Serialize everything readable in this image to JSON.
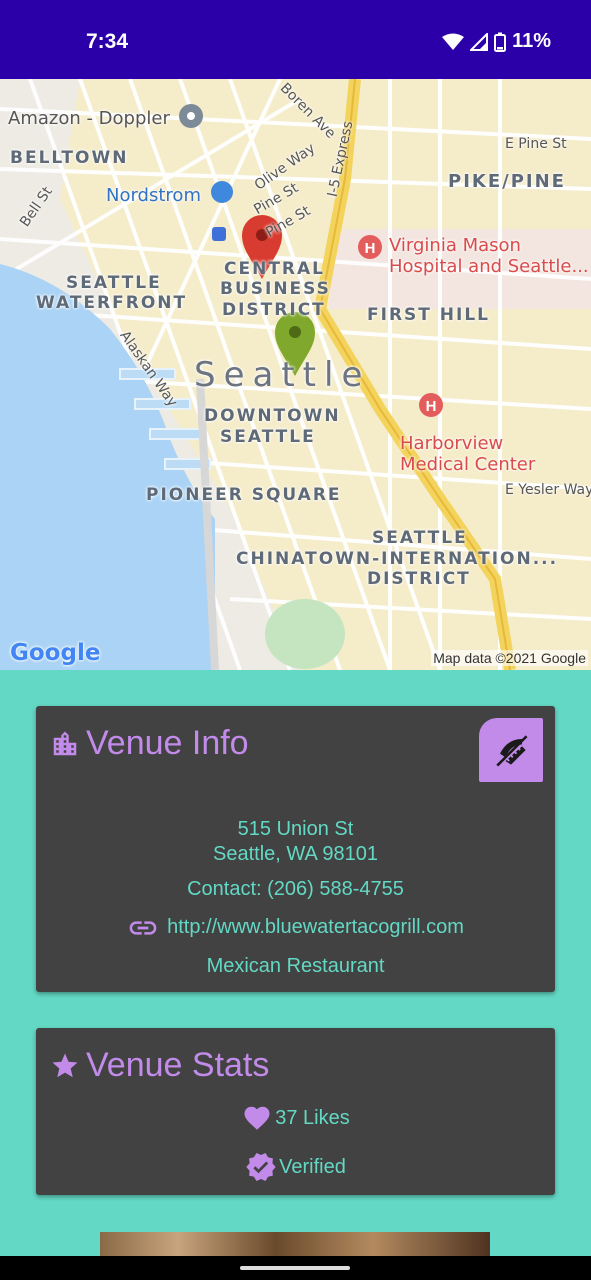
{
  "status_bar": {
    "time": "7:34",
    "battery": "11%"
  },
  "map": {
    "labels": {
      "amazon": "Amazon - Doppler",
      "belltown": "BELLTOWN",
      "nordstrom": "Nordstrom",
      "olive_way": "Olive Way",
      "boren_ave": "Boren Ave",
      "pine_st_1": "Pine St",
      "pine_st_2": "Pine St",
      "i5_express": "I-5 Express",
      "e_pine_st": "E Pine St",
      "pike_pine": "PIKE/PINE",
      "bell_st": "Bell St",
      "virginia_mason": "Virginia Mason\nHospital and Seattle...",
      "central_1": "CENTRAL",
      "central_2": "BUSINESS",
      "central_3": "DISTRICT",
      "waterfront_1": "SEATTLE",
      "waterfront_2": "WATERFRONT",
      "first_hill": "FIRST HILL",
      "alaskan_way": "Alaskan Way",
      "seattle": "Seattle",
      "downtown_1": "DOWNTOWN",
      "downtown_2": "SEATTLE",
      "harborview": "Harborview\nMedical Center",
      "pioneer_square": "PIONEER SQUARE",
      "e_yesler_way": "E Yesler Way",
      "chinatown_1": "SEATTLE",
      "chinatown_2": "CHINATOWN-INTERNATION...",
      "chinatown_3": "DISTRICT"
    },
    "google_logo": "Google",
    "attribution": "Map data ©2021 Google",
    "colors": {
      "water": "#aad3f5",
      "freeway": "#f3d35b",
      "marker_red": "#d83b2f",
      "marker_green": "#7fa82d"
    }
  },
  "venue_info": {
    "title": "Venue Info",
    "title_icon": "city-icon",
    "toggle_icon": "no-food-icon",
    "address_line1": "515 Union St",
    "address_line2": "Seattle, WA 98101",
    "contact": "Contact: (206) 588-4755",
    "website_icon": "link-icon",
    "website": "http://www.bluewatertacogrill.com",
    "category": "Mexican Restaurant"
  },
  "venue_stats": {
    "title": "Venue Stats",
    "title_icon": "star-icon",
    "likes_icon": "heart-icon",
    "likes": "37 Likes",
    "verified_icon": "verified-badge-icon",
    "verified": "Verified"
  },
  "theme": {
    "background": "#63d8c4",
    "card": "#424242",
    "accent": "#c28bea",
    "status_bar": "#2b00a8"
  }
}
